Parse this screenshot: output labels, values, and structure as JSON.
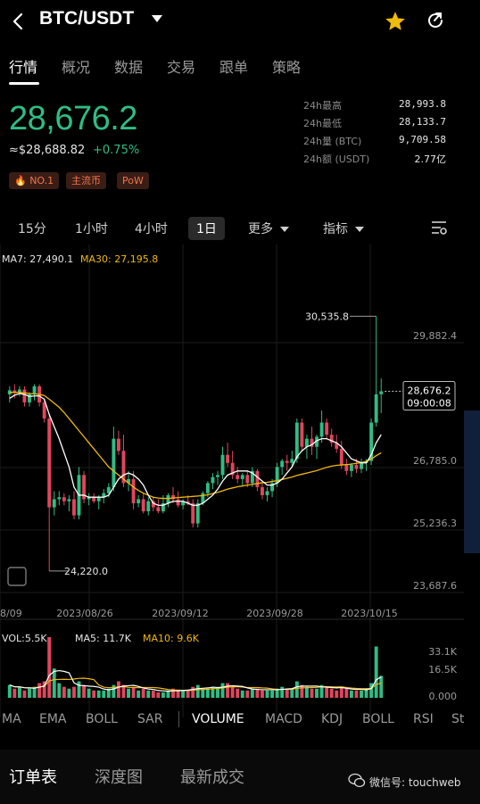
{
  "header": {
    "pair": "BTC/USDT"
  },
  "tabs": [
    "行情",
    "概况",
    "数据",
    "交易",
    "跟单",
    "策略"
  ],
  "ticker": {
    "last_price": "28,676.2",
    "approx_usd": "≈$28,688.82",
    "change_pct": "+0.75%",
    "badges": [
      "🔥 NO.1",
      "主流币",
      "PoW"
    ],
    "stats": [
      {
        "label": "24h最高",
        "value": "28,993.8"
      },
      {
        "label": "24h最低",
        "value": "28,133.7"
      },
      {
        "label": "24h量 (BTC)",
        "value": "9,709.58"
      },
      {
        "label": "24h额 (USDT)",
        "value": "2.77亿"
      }
    ]
  },
  "intervals": [
    "15分",
    "1小时",
    "4小时",
    "1日",
    "更多",
    "指标"
  ],
  "active_interval": "1日",
  "overlay": {
    "ma7_label": "MA7: 27,490.1",
    "ma30_label": "MA30: 27,195.8",
    "high_marker": "30,535.8",
    "low_marker": "24,220.0",
    "current_price": "28,676.2",
    "countdown": "09:00:08",
    "vol_label": "VOL:5.5K",
    "ma5_label": "MA5: 11.7K",
    "ma10_label": "MA10: 9.6K"
  },
  "colors": {
    "up": "#2ebd85",
    "down": "#e0465e",
    "ma7": "#ffffff",
    "ma30": "#f0b90b",
    "ma10_vol": "#f0b90b"
  },
  "chart_data": {
    "type": "candlestick",
    "y_ticks": [
      "29,882.4",
      "26,785.0",
      "25,236.3",
      "23,687.6"
    ],
    "y_tick_values": [
      29882.4,
      26785.0,
      25236.3,
      23687.6
    ],
    "x_ticks": [
      "8/09",
      "2023/08/26",
      "2023/09/12",
      "2023/09/28",
      "2023/10/15"
    ],
    "ylim": [
      23687.6,
      31430
    ],
    "vol_ticks": [
      "33.1K",
      "16.5K",
      "0.000"
    ],
    "vol_ylim": [
      0,
      33.1
    ],
    "candles": [
      {
        "o": 28600,
        "h": 28800,
        "l": 28400,
        "c": 28700
      },
      {
        "o": 28700,
        "h": 28850,
        "l": 28500,
        "c": 28650
      },
      {
        "o": 28650,
        "h": 28800,
        "l": 28550,
        "c": 28720
      },
      {
        "o": 28720,
        "h": 28800,
        "l": 28300,
        "c": 28400
      },
      {
        "o": 28400,
        "h": 28650,
        "l": 28300,
        "c": 28600
      },
      {
        "o": 28600,
        "h": 28850,
        "l": 28450,
        "c": 28800
      },
      {
        "o": 28800,
        "h": 28850,
        "l": 28300,
        "c": 28400
      },
      {
        "o": 28400,
        "h": 28500,
        "l": 27900,
        "c": 28000
      },
      {
        "o": 28000,
        "h": 28100,
        "l": 24220,
        "c": 25800
      },
      {
        "o": 25800,
        "h": 26200,
        "l": 25600,
        "c": 26000
      },
      {
        "o": 26000,
        "h": 26200,
        "l": 25850,
        "c": 26050
      },
      {
        "o": 26050,
        "h": 26150,
        "l": 25850,
        "c": 25950
      },
      {
        "o": 25950,
        "h": 26100,
        "l": 25700,
        "c": 26000
      },
      {
        "o": 26000,
        "h": 26200,
        "l": 25500,
        "c": 25600
      },
      {
        "o": 25600,
        "h": 26800,
        "l": 25500,
        "c": 26600
      },
      {
        "o": 26600,
        "h": 26700,
        "l": 25900,
        "c": 26000
      },
      {
        "o": 26000,
        "h": 26150,
        "l": 25850,
        "c": 26050
      },
      {
        "o": 26050,
        "h": 26150,
        "l": 25900,
        "c": 25950
      },
      {
        "o": 25950,
        "h": 26100,
        "l": 25750,
        "c": 26050
      },
      {
        "o": 26050,
        "h": 26250,
        "l": 25900,
        "c": 26150
      },
      {
        "o": 26150,
        "h": 26400,
        "l": 26050,
        "c": 26300
      },
      {
        "o": 26300,
        "h": 27800,
        "l": 26200,
        "c": 27500
      },
      {
        "o": 27500,
        "h": 27700,
        "l": 27100,
        "c": 27200
      },
      {
        "o": 27200,
        "h": 27600,
        "l": 26300,
        "c": 26400
      },
      {
        "o": 26400,
        "h": 26700,
        "l": 26200,
        "c": 26500
      },
      {
        "o": 26500,
        "h": 26700,
        "l": 25750,
        "c": 25900
      },
      {
        "o": 25900,
        "h": 26100,
        "l": 25800,
        "c": 26000
      },
      {
        "o": 26000,
        "h": 26150,
        "l": 25650,
        "c": 25700
      },
      {
        "o": 25700,
        "h": 26050,
        "l": 25600,
        "c": 25950
      },
      {
        "o": 25950,
        "h": 26050,
        "l": 25700,
        "c": 25800
      },
      {
        "o": 25800,
        "h": 26000,
        "l": 25650,
        "c": 25700
      },
      {
        "o": 25700,
        "h": 26100,
        "l": 25650,
        "c": 25900
      },
      {
        "o": 25900,
        "h": 26150,
        "l": 25800,
        "c": 26100
      },
      {
        "o": 26100,
        "h": 26300,
        "l": 25900,
        "c": 26000
      },
      {
        "o": 26000,
        "h": 26200,
        "l": 25800,
        "c": 25850
      },
      {
        "o": 25850,
        "h": 26000,
        "l": 25750,
        "c": 25950
      },
      {
        "o": 25950,
        "h": 26100,
        "l": 25850,
        "c": 25900
      },
      {
        "o": 25900,
        "h": 26000,
        "l": 25300,
        "c": 25400
      },
      {
        "o": 25400,
        "h": 26000,
        "l": 25300,
        "c": 25900
      },
      {
        "o": 25900,
        "h": 26200,
        "l": 25850,
        "c": 26150
      },
      {
        "o": 26150,
        "h": 26450,
        "l": 26050,
        "c": 26400
      },
      {
        "o": 26400,
        "h": 26650,
        "l": 26250,
        "c": 26550
      },
      {
        "o": 26550,
        "h": 26700,
        "l": 26350,
        "c": 26600
      },
      {
        "o": 26600,
        "h": 27300,
        "l": 26500,
        "c": 27100
      },
      {
        "o": 27100,
        "h": 27400,
        "l": 26800,
        "c": 26900
      },
      {
        "o": 26900,
        "h": 27200,
        "l": 26500,
        "c": 26600
      },
      {
        "o": 26600,
        "h": 26800,
        "l": 26400,
        "c": 26500
      },
      {
        "o": 26500,
        "h": 26650,
        "l": 26350,
        "c": 26600
      },
      {
        "o": 26600,
        "h": 26700,
        "l": 26300,
        "c": 26400
      },
      {
        "o": 26400,
        "h": 26800,
        "l": 26300,
        "c": 26700
      },
      {
        "o": 26700,
        "h": 26750,
        "l": 26200,
        "c": 26300
      },
      {
        "o": 26300,
        "h": 26400,
        "l": 26000,
        "c": 26100
      },
      {
        "o": 26100,
        "h": 26300,
        "l": 25950,
        "c": 26200
      },
      {
        "o": 26200,
        "h": 26500,
        "l": 26050,
        "c": 26400
      },
      {
        "o": 26400,
        "h": 26900,
        "l": 26300,
        "c": 26800
      },
      {
        "o": 26800,
        "h": 27000,
        "l": 26600,
        "c": 26950
      },
      {
        "o": 26950,
        "h": 27100,
        "l": 26700,
        "c": 26900
      },
      {
        "o": 26900,
        "h": 27200,
        "l": 26800,
        "c": 27000
      },
      {
        "o": 27000,
        "h": 28000,
        "l": 26900,
        "c": 27900
      },
      {
        "o": 27900,
        "h": 28000,
        "l": 27200,
        "c": 27300
      },
      {
        "o": 27300,
        "h": 27600,
        "l": 27000,
        "c": 27500
      },
      {
        "o": 27500,
        "h": 27800,
        "l": 27100,
        "c": 27300
      },
      {
        "o": 27300,
        "h": 27600,
        "l": 27000,
        "c": 27550
      },
      {
        "o": 27550,
        "h": 28200,
        "l": 27400,
        "c": 27900
      },
      {
        "o": 27900,
        "h": 28000,
        "l": 27500,
        "c": 27600
      },
      {
        "o": 27600,
        "h": 27750,
        "l": 27300,
        "c": 27400
      },
      {
        "o": 27400,
        "h": 27600,
        "l": 27150,
        "c": 27250
      },
      {
        "o": 27250,
        "h": 27450,
        "l": 26750,
        "c": 26850
      },
      {
        "o": 26850,
        "h": 27000,
        "l": 26600,
        "c": 26700
      },
      {
        "o": 26700,
        "h": 26900,
        "l": 26550,
        "c": 26850
      },
      {
        "o": 26850,
        "h": 27000,
        "l": 26650,
        "c": 26750
      },
      {
        "o": 26750,
        "h": 27000,
        "l": 26650,
        "c": 26900
      },
      {
        "o": 26900,
        "h": 27000,
        "l": 26700,
        "c": 26950
      },
      {
        "o": 26950,
        "h": 28000,
        "l": 26850,
        "c": 27900
      },
      {
        "o": 27900,
        "h": 30535.8,
        "l": 27800,
        "c": 28600
      },
      {
        "o": 28600,
        "h": 28993.8,
        "l": 28133.7,
        "c": 28676.2
      }
    ],
    "ma7": [
      28500,
      28580,
      28620,
      28600,
      28550,
      28560,
      28560,
      28480,
      28100,
      27800,
      27500,
      27150,
      26800,
      26300,
      26100,
      26100,
      26050,
      26050,
      26050,
      26050,
      26100,
      26300,
      26500,
      26600,
      26650,
      26600,
      26500,
      26350,
      26100,
      25900,
      25850,
      25850,
      25900,
      25950,
      25950,
      25950,
      25900,
      25850,
      25850,
      25900,
      26000,
      26100,
      26250,
      26450,
      26600,
      26650,
      26700,
      26700,
      26700,
      26650,
      26550,
      26450,
      26350,
      26350,
      26400,
      26500,
      26650,
      26800,
      27050,
      27200,
      27300,
      27350,
      27450,
      27500,
      27500,
      27450,
      27400,
      27300,
      27150,
      27000,
      26950,
      26900,
      26900,
      27100,
      27400,
      27600
    ],
    "ma30": [
      28650,
      28650,
      28650,
      28640,
      28620,
      28610,
      28600,
      28570,
      28480,
      28380,
      28280,
      28150,
      28000,
      27850,
      27700,
      27550,
      27400,
      27250,
      27100,
      26950,
      26800,
      26700,
      26600,
      26500,
      26400,
      26300,
      26220,
      26150,
      26100,
      26050,
      26030,
      26020,
      26020,
      26030,
      26040,
      26050,
      26060,
      26070,
      26080,
      26090,
      26110,
      26140,
      26170,
      26210,
      26250,
      26280,
      26310,
      26330,
      26350,
      26370,
      26390,
      26410,
      26420,
      26440,
      26460,
      26490,
      26520,
      26550,
      26590,
      26620,
      26650,
      26680,
      26710,
      26750,
      26790,
      26820,
      26840,
      26850,
      26860,
      26870,
      26890,
      26910,
      26940,
      27000,
      27080,
      27150
    ],
    "volumes": [
      7,
      5,
      6,
      4,
      5,
      6,
      8,
      9,
      33.1,
      16,
      8,
      6,
      5,
      6,
      9,
      7,
      5,
      4,
      4,
      4,
      5,
      7,
      9,
      7,
      5,
      6,
      4,
      5,
      4,
      4,
      3,
      3,
      4,
      5,
      4,
      4,
      4,
      6,
      7,
      5,
      5,
      6,
      5,
      8,
      8,
      6,
      5,
      4,
      4,
      5,
      5,
      4,
      4,
      4,
      5,
      6,
      5,
      5,
      9,
      7,
      6,
      5,
      5,
      7,
      6,
      5,
      4,
      6,
      5,
      4,
      4,
      4,
      5,
      8,
      28,
      12
    ]
  },
  "indicators": [
    "MA",
    "EMA",
    "BOLL",
    "SAR",
    "VOLUME",
    "MACD",
    "KDJ",
    "BOLL",
    "RSI",
    "St"
  ],
  "active_indicator": "VOLUME",
  "bottom_tabs": [
    "订单表",
    "深度图",
    "最新成交"
  ],
  "watermark": "微信号: touchweb"
}
